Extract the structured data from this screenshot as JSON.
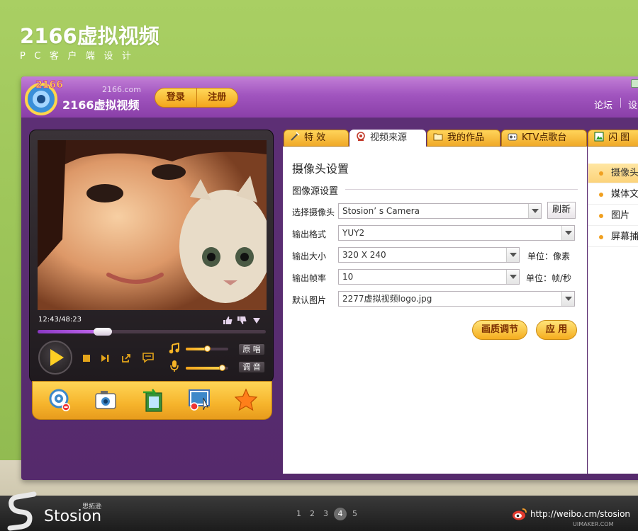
{
  "page": {
    "title": "2166虚拟视频",
    "subtitle": "PC客户端设计"
  },
  "app": {
    "site_url": "2166.com",
    "name": "2166虚拟视频",
    "login_label": "登录",
    "register_label": "注册",
    "top_links": [
      "论坛",
      "设"
    ]
  },
  "player": {
    "time": "12:43/48:23",
    "progress": 0.29,
    "music_volume": 0.5,
    "mic_volume": 0.85,
    "original_label": "原 唱",
    "tune_label": "调 音",
    "tools": [
      "webcam-effect-icon",
      "camera-snapshot-icon",
      "video-export-icon",
      "screen-capture-icon",
      "favorite-star-icon"
    ]
  },
  "tabs": [
    {
      "label": "特 效",
      "icon": "magic-wand-icon"
    },
    {
      "label": "视频来源",
      "icon": "webcam-icon"
    },
    {
      "label": "我的作品",
      "icon": "folder-icon"
    },
    {
      "label": "KTV点歌台",
      "icon": "ktv-icon"
    },
    {
      "label": "闪 图",
      "icon": "flash-image-icon"
    }
  ],
  "camera_settings": {
    "section_title": "摄像头设置",
    "group_title": "图像源设置",
    "fields": [
      {
        "label": "选择摄像头",
        "value": "Stosion’ s Camera"
      },
      {
        "label": "输出格式",
        "value": "YUY2"
      },
      {
        "label": "输出大小",
        "value": "320 X 240",
        "unit": "单位：像素"
      },
      {
        "label": "输出帧率",
        "value": "10",
        "unit": "单位：帧/秒"
      },
      {
        "label": "默认图片",
        "value": "2277虚拟视频logo.jpg"
      }
    ],
    "refresh_label": "刷新",
    "quality_label": "画质调节",
    "apply_label": "应 用"
  },
  "side_menu": [
    {
      "label": "摄像头",
      "active": true
    },
    {
      "label": "媒体文",
      "active": false
    },
    {
      "label": "图片",
      "active": false
    },
    {
      "label": "屏幕捕",
      "active": false
    }
  ],
  "footer": {
    "brand_cn": "思拓逊",
    "brand_en": "Stosion",
    "pages": [
      "1",
      "2",
      "3",
      "4",
      "5"
    ],
    "current_page": "4",
    "weibo_url": "http://weibo.cm/stosion",
    "watermark": "UIMAKER.COM"
  },
  "colors": {
    "background_green": "#9ec65a",
    "window_purple": "#5b2d72",
    "accent_orange": "#f5ad1e",
    "progress_purple": "#b35ee8"
  }
}
